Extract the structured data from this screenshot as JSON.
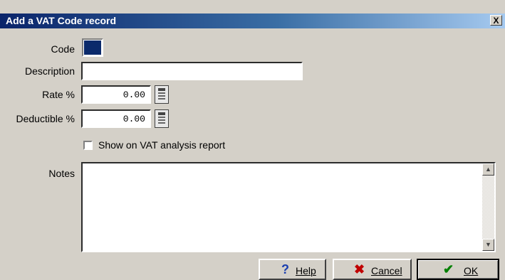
{
  "window": {
    "title": "Add a VAT Code record",
    "close_label": "X"
  },
  "form": {
    "code_label": "Code",
    "code_color": "#0b2a6b",
    "description_label": "Description",
    "description_value": "",
    "rate_label": "Rate %",
    "rate_value": "0.00",
    "deductible_label": "Deductible %",
    "deductible_value": "0.00",
    "show_report_label": "Show on VAT analysis report",
    "show_report_checked": false,
    "notes_label": "Notes",
    "notes_value": ""
  },
  "buttons": {
    "help_label": "Help",
    "cancel_label": "Cancel",
    "ok_label": "OK"
  },
  "icons": {
    "calculator": "calculator-icon",
    "help": "help-icon",
    "cancel": "cancel-icon",
    "ok": "ok-icon"
  }
}
